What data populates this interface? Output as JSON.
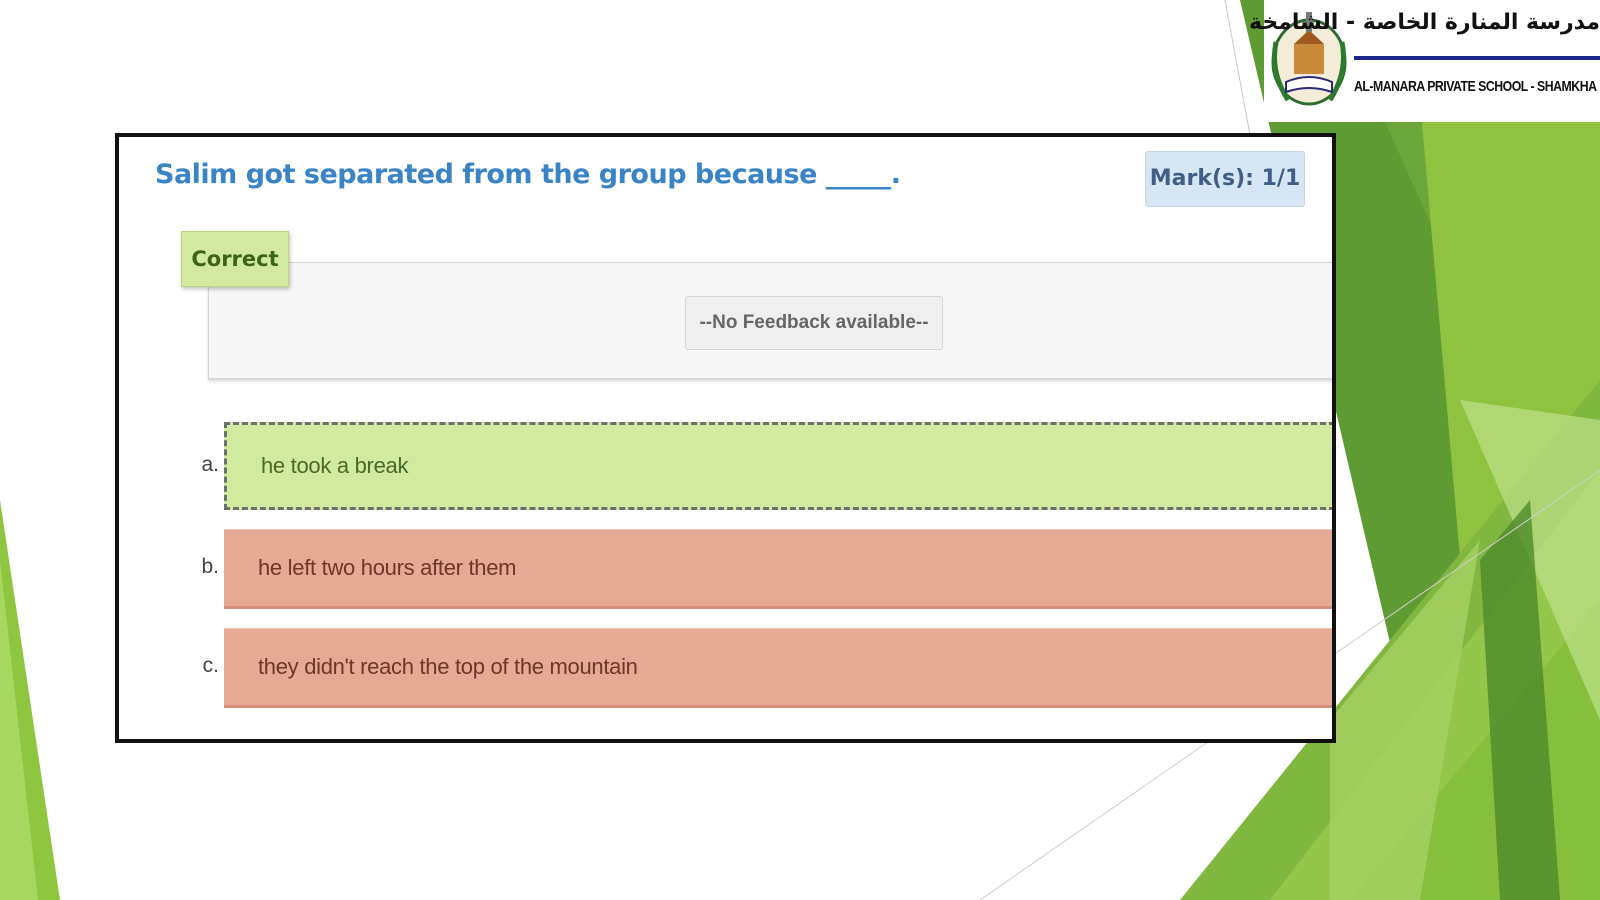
{
  "branding": {
    "arabic_name": "مدرسة المنارة الخاصة - الشامخة",
    "english_name": "AL-MANARA PRIVATE SCHOOL - SHAMKHA",
    "emblem_icon": "school-crest-icon"
  },
  "question": {
    "text": "Salim got separated from the group because _____.",
    "marks": "Mark(s): 1/1",
    "status": "Correct",
    "feedback": "--No Feedback available--"
  },
  "options": [
    {
      "letter": "a.",
      "text": "he took a break",
      "state": "selected-correct"
    },
    {
      "letter": "b.",
      "text": "he left two hours after them",
      "state": "incorrect"
    },
    {
      "letter": "c.",
      "text": "they didn't reach the top of the mountain",
      "state": "incorrect"
    }
  ],
  "colors": {
    "question": "#3a84c6",
    "correct_bg": "#d2e9a0",
    "incorrect_bg": "#e6a996",
    "marks_bg": "#d6e6f4",
    "slide_green": "#7ab648"
  }
}
